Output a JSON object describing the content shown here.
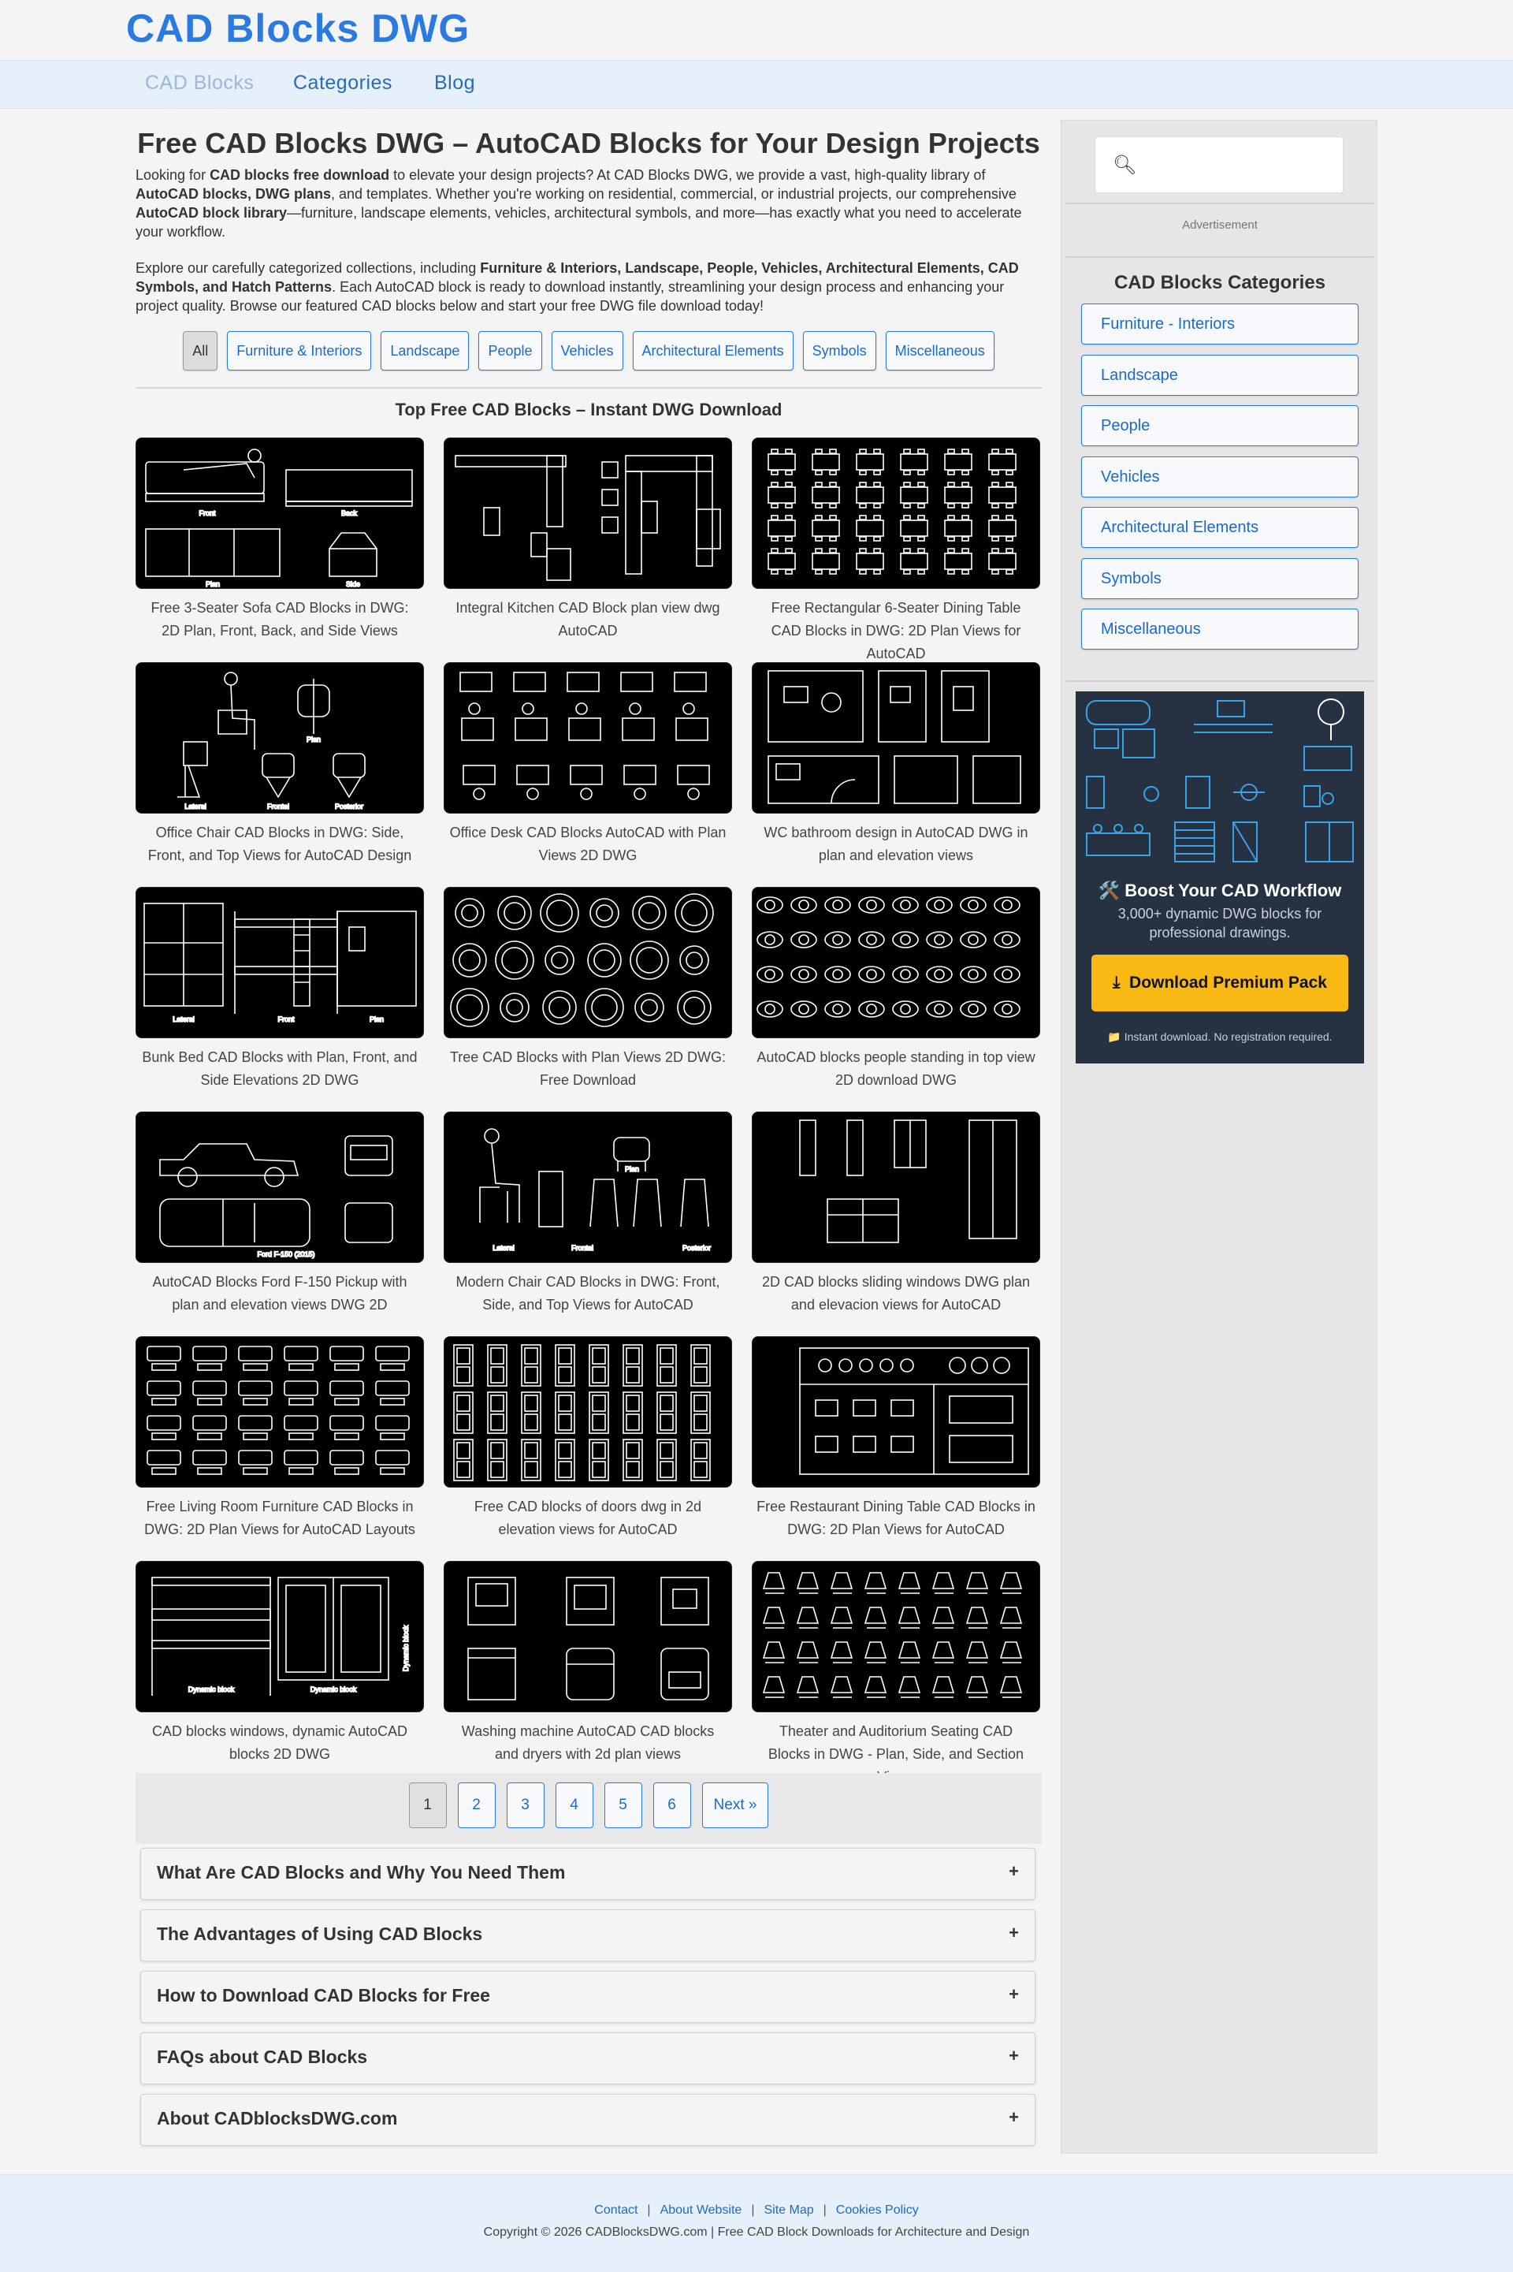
{
  "site": {
    "logo": "CAD Blocks DWG"
  },
  "nav": [
    {
      "label": "CAD Blocks"
    },
    {
      "label": "Categories"
    },
    {
      "label": "Blog"
    }
  ],
  "main": {
    "title": "Free CAD Blocks DWG – AutoCAD Blocks for Your Design Projects",
    "intro1": "Looking for <b>CAD blocks free download</b> to elevate your design projects? At CAD Blocks DWG, we provide a vast, high-quality library of <b>AutoCAD blocks, DWG plans</b>, and templates. Whether you're working on residential, commercial, or industrial projects, our comprehensive <b>AutoCAD block library</b>—furniture, landscape elements, vehicles, architectural symbols, and more—has exactly what you need to accelerate your workflow.",
    "intro2": "Explore our carefully categorized collections, including <b>Furniture &amp; Interiors, Landscape, People, Vehicles, Architectural Elements, CAD Symbols, and Hatch Patterns</b>. Each AutoCAD block is ready to download instantly, streamlining your design process and enhancing your project quality. Browse our featured CAD blocks below and start your free DWG file download today!",
    "filters": [
      "All",
      "Furniture & Interiors",
      "Landscape",
      "People",
      "Vehicles",
      "Architectural Elements",
      "Symbols",
      "Miscellaneous"
    ],
    "grid_title": "Top Free CAD Blocks – Instant DWG Download",
    "items": [
      {
        "caption": "Free 3-Seater Sofa CAD Blocks in DWG: 2D Plan, Front, Back, and Side Views"
      },
      {
        "caption": "Integral Kitchen CAD Block plan view dwg AutoCAD"
      },
      {
        "caption": "Free Rectangular 6-Seater Dining Table CAD Blocks in DWG: 2D Plan Views for AutoCAD"
      },
      {
        "caption": "Office Chair CAD Blocks in DWG: Side, Front, and Top Views for AutoCAD Design"
      },
      {
        "caption": "Office Desk CAD Blocks AutoCAD with Plan Views 2D DWG"
      },
      {
        "caption": "WC bathroom design in AutoCAD DWG in plan and elevation views"
      },
      {
        "caption": "Bunk Bed CAD Blocks with Plan, Front, and Side Elevations 2D DWG"
      },
      {
        "caption": "Tree CAD Blocks with Plan Views 2D DWG: Free Download"
      },
      {
        "caption": "AutoCAD blocks people standing in top view 2D download DWG"
      },
      {
        "caption": "AutoCAD Blocks Ford F-150 Pickup with plan and elevation views DWG 2D"
      },
      {
        "caption": "Modern Chair CAD Blocks in DWG: Front, Side, and Top Views for AutoCAD"
      },
      {
        "caption": "2D CAD blocks sliding windows DWG plan and elevacion views for AutoCAD"
      },
      {
        "caption": "Free Living Room Furniture CAD Blocks in DWG: 2D Plan Views for AutoCAD Layouts"
      },
      {
        "caption": "Free CAD blocks of doors dwg in 2d elevation views for AutoCAD"
      },
      {
        "caption": "Free Restaurant Dining Table CAD Blocks in DWG: 2D Plan Views for AutoCAD"
      },
      {
        "caption": "CAD blocks windows, dynamic AutoCAD blocks 2D DWG"
      },
      {
        "caption": "Washing machine AutoCAD CAD blocks and dryers with 2d plan views"
      },
      {
        "caption": "Theater and Auditorium Seating CAD Blocks in DWG - Plan, Side, and Section Views"
      }
    ],
    "thumb_labels": {
      "sofa": [
        "Front",
        "Back",
        "Plan",
        "Side"
      ],
      "chair": [
        "Lateral",
        "Plan",
        "Frontal",
        "Posterior"
      ],
      "bunk": [
        "Lateral",
        "Front",
        "Plan"
      ],
      "ford": "Ford F-150 (2015)",
      "modern_chair": [
        "Plan",
        "Lateral",
        "Frontal",
        "Posterior"
      ],
      "windows": [
        "Dynamic block",
        "Dynamic block",
        "Dynamic block"
      ]
    },
    "pagination": [
      "1",
      "2",
      "3",
      "4",
      "5",
      "6",
      "Next »"
    ],
    "accordion": [
      "What Are CAD Blocks and Why You Need Them",
      "The Advantages of Using CAD Blocks",
      "How to Download CAD Blocks for Free",
      "FAQs about CAD Blocks",
      "About CADblocksDWG.com"
    ]
  },
  "sidebar": {
    "ad_label": "Advertisement",
    "categories_title": "CAD Blocks Categories",
    "categories": [
      "Furniture - Interiors",
      "Landscape",
      "People",
      "Vehicles",
      "Architectural Elements",
      "Symbols",
      "Miscellaneous"
    ],
    "promo": {
      "heading": "🛠️ Boost Your CAD Workflow",
      "sub": "3,000+ dynamic DWG blocks for professional drawings.",
      "button": "Download Premium Pack",
      "note": "📁 Instant download. No registration required."
    }
  },
  "footer": {
    "links": [
      "Contact",
      "About Website",
      "Site Map",
      "Cookies Policy"
    ],
    "copyright": "Copyright © 2026 CADBlocksDWG.com  |  Free CAD Block Downloads for Architecture and Design"
  },
  "colors": {
    "accent": "#2a7ae2",
    "nav_bg": "#e6f0fb",
    "promo_bg": "#263241",
    "promo_button": "#f9b914"
  }
}
